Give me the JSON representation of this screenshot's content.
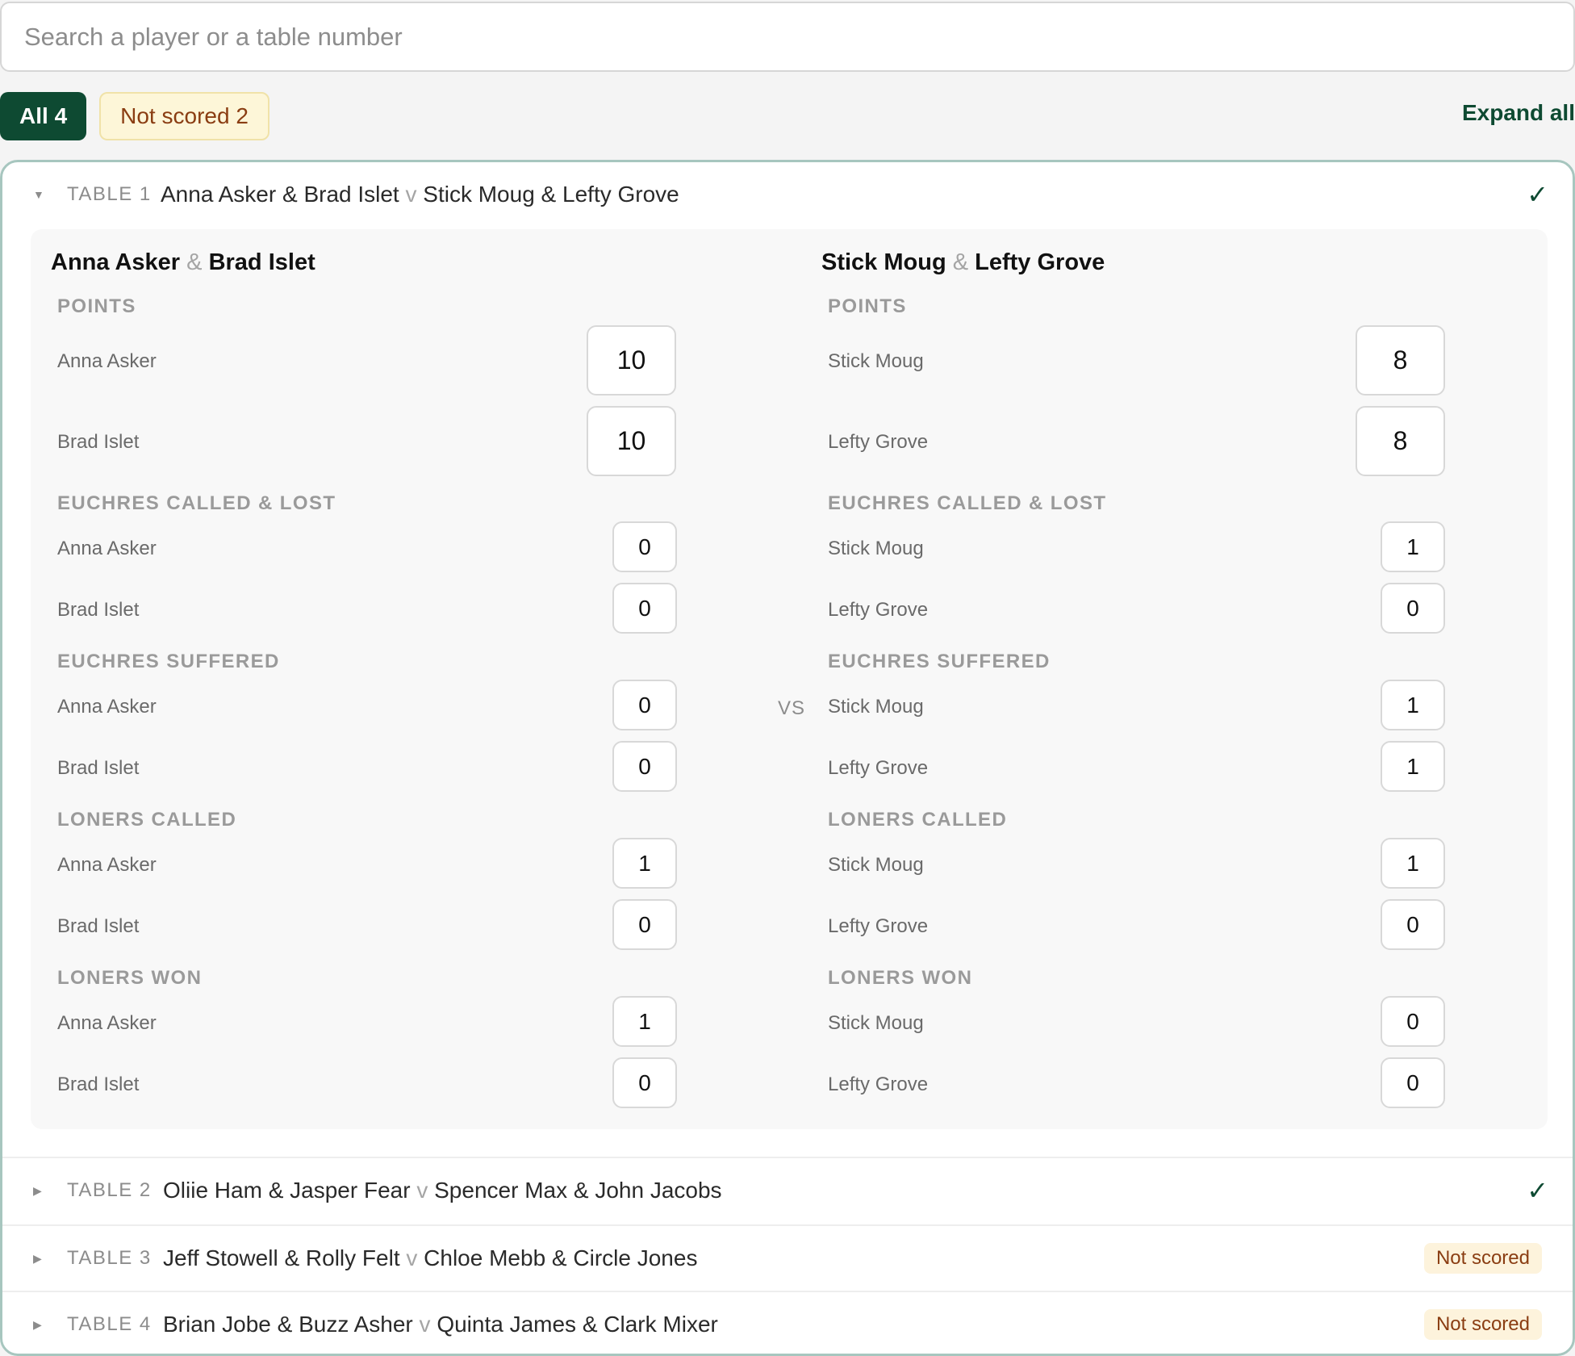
{
  "search": {
    "placeholder": "Search a player or a table number"
  },
  "filters": {
    "all": {
      "label": "All",
      "count": "4"
    },
    "not_scored": {
      "label": "Not scored",
      "count": "2"
    },
    "expand_all": "Expand all"
  },
  "tables": [
    {
      "label": "TABLE 1",
      "team_a": {
        "p1": "Anna Asker",
        "p2": "Brad Islet"
      },
      "team_b": {
        "p1": "Stick Moug",
        "p2": "Lefty Grove"
      },
      "versus": "v",
      "status": "scored",
      "status_icon": "check-icon",
      "status_glyph": "✓",
      "expanded": true
    },
    {
      "label": "TABLE 2",
      "team_a": {
        "p1": "Oliie Ham",
        "p2": "Jasper Fear"
      },
      "team_b": {
        "p1": "Spencer Max",
        "p2": "John Jacobs"
      },
      "versus": "v",
      "status": "scored",
      "status_glyph": "✓",
      "expanded": false
    },
    {
      "label": "TABLE 3",
      "team_a": {
        "p1": "Jeff Stowell",
        "p2": "Rolly Felt"
      },
      "team_b": {
        "p1": "Chloe Mebb",
        "p2": "Circle Jones"
      },
      "versus": "v",
      "status": "not_scored",
      "status_label": "Not scored",
      "expanded": false
    },
    {
      "label": "TABLE 4",
      "team_a": {
        "p1": "Brian Jobe",
        "p2": "Buzz Asher"
      },
      "team_b": {
        "p1": "Quinta James",
        "p2": "Clark Mixer"
      },
      "versus": "v",
      "status": "not_scored",
      "status_label": "Not scored",
      "expanded": false
    }
  ],
  "detail": {
    "amp": "&",
    "vs": "VS",
    "sections": {
      "points": "POINTS",
      "euchres_called_lost": "EUCHRES CALLED & LOST",
      "euchres_suffered": "EUCHRES SUFFERED",
      "loners_called": "LONERS CALLED",
      "loners_won": "LONERS WON"
    },
    "team_a": {
      "p1": "Anna Asker",
      "p2": "Brad Islet",
      "points": [
        "10",
        "10"
      ],
      "euchres_called_lost": [
        "0",
        "0"
      ],
      "euchres_suffered": [
        "0",
        "0"
      ],
      "loners_called": [
        "1",
        "0"
      ],
      "loners_won": [
        "1",
        "0"
      ]
    },
    "team_b": {
      "p1": "Stick Moug",
      "p2": "Lefty Grove",
      "points": [
        "8",
        "8"
      ],
      "euchres_called_lost": [
        "1",
        "0"
      ],
      "euchres_suffered": [
        "1",
        "1"
      ],
      "loners_called": [
        "1",
        "0"
      ],
      "loners_won": [
        "0",
        "0"
      ]
    }
  },
  "colors": {
    "accent": "#0e4a32",
    "not_scored_text": "#8a3d12",
    "not_scored_bg": "#fdf6d8",
    "card_border": "#a7c6bf"
  }
}
